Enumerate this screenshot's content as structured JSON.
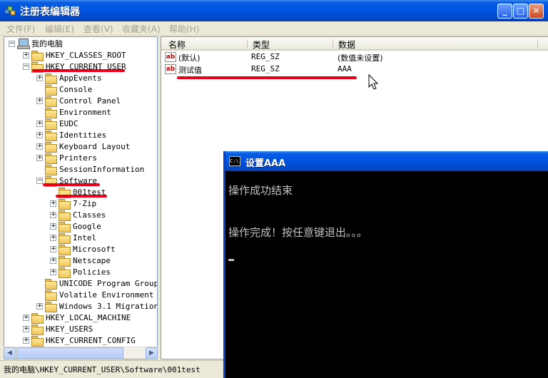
{
  "window": {
    "title": "注册表编辑器"
  },
  "menu": [
    "文件(F)",
    "编辑(E)",
    "查看(V)",
    "收藏夹(A)",
    "帮助(H)"
  ],
  "tree": [
    {
      "label": "我的电脑",
      "level": 0,
      "exp": "−",
      "kind": "computer"
    },
    {
      "label": "HKEY_CLASSES_ROOT",
      "level": 1,
      "exp": "+",
      "kind": "folder"
    },
    {
      "label": "HKEY_CURRENT_USER",
      "level": 1,
      "exp": "−",
      "kind": "folder"
    },
    {
      "label": "AppEvents",
      "level": 2,
      "exp": "+",
      "kind": "folder"
    },
    {
      "label": "Console",
      "level": 2,
      "exp": "",
      "kind": "folder"
    },
    {
      "label": "Control Panel",
      "level": 2,
      "exp": "+",
      "kind": "folder"
    },
    {
      "label": "Environment",
      "level": 2,
      "exp": "",
      "kind": "folder"
    },
    {
      "label": "EUDC",
      "level": 2,
      "exp": "+",
      "kind": "folder"
    },
    {
      "label": "Identities",
      "level": 2,
      "exp": "+",
      "kind": "folder"
    },
    {
      "label": "Keyboard Layout",
      "level": 2,
      "exp": "+",
      "kind": "folder"
    },
    {
      "label": "Printers",
      "level": 2,
      "exp": "+",
      "kind": "folder"
    },
    {
      "label": "SessionInformation",
      "level": 2,
      "exp": "",
      "kind": "folder"
    },
    {
      "label": "Software",
      "level": 2,
      "exp": "−",
      "kind": "folder"
    },
    {
      "label": "001test",
      "level": 3,
      "exp": "",
      "kind": "folder"
    },
    {
      "label": "7-Zip",
      "level": 3,
      "exp": "+",
      "kind": "folder"
    },
    {
      "label": "Classes",
      "level": 3,
      "exp": "+",
      "kind": "folder"
    },
    {
      "label": "Google",
      "level": 3,
      "exp": "+",
      "kind": "folder"
    },
    {
      "label": "Intel",
      "level": 3,
      "exp": "+",
      "kind": "folder"
    },
    {
      "label": "Microsoft",
      "level": 3,
      "exp": "+",
      "kind": "folder"
    },
    {
      "label": "Netscape",
      "level": 3,
      "exp": "+",
      "kind": "folder"
    },
    {
      "label": "Policies",
      "level": 3,
      "exp": "+",
      "kind": "folder"
    },
    {
      "label": "UNICODE Program Groups",
      "level": 2,
      "exp": "",
      "kind": "folder"
    },
    {
      "label": "Volatile Environment",
      "level": 2,
      "exp": "",
      "kind": "folder"
    },
    {
      "label": "Windows 3.1 Migration",
      "level": 2,
      "exp": "+",
      "kind": "folder"
    },
    {
      "label": "HKEY_LOCAL_MACHINE",
      "level": 1,
      "exp": "+",
      "kind": "folder"
    },
    {
      "label": "HKEY_USERS",
      "level": 1,
      "exp": "+",
      "kind": "folder"
    },
    {
      "label": "HKEY_CURRENT_CONFIG",
      "level": 1,
      "exp": "+",
      "kind": "folder"
    }
  ],
  "list": {
    "headers": [
      "名称",
      "类型",
      "数据"
    ],
    "rows": [
      {
        "name": "(默认)",
        "type": "REG_SZ",
        "data": "(数值未设置)"
      },
      {
        "name": "测试值",
        "type": "REG_SZ",
        "data": "AAA"
      }
    ]
  },
  "status": "我的电脑\\HKEY_CURRENT_USER\\Software\\001test",
  "console": {
    "title": "设置AAA",
    "lines": [
      "操作成功结束",
      "操作完成！按任意键退出。。。"
    ]
  },
  "icons": {
    "app": "registry-editor-icon",
    "value": "string-value-ab-icon",
    "console": "cmd-icon"
  },
  "colors": {
    "titlebar": "#0054e3",
    "highlight_marks": "#e8001b",
    "console_bg": "#000000",
    "console_text": "#c0c0c0"
  }
}
